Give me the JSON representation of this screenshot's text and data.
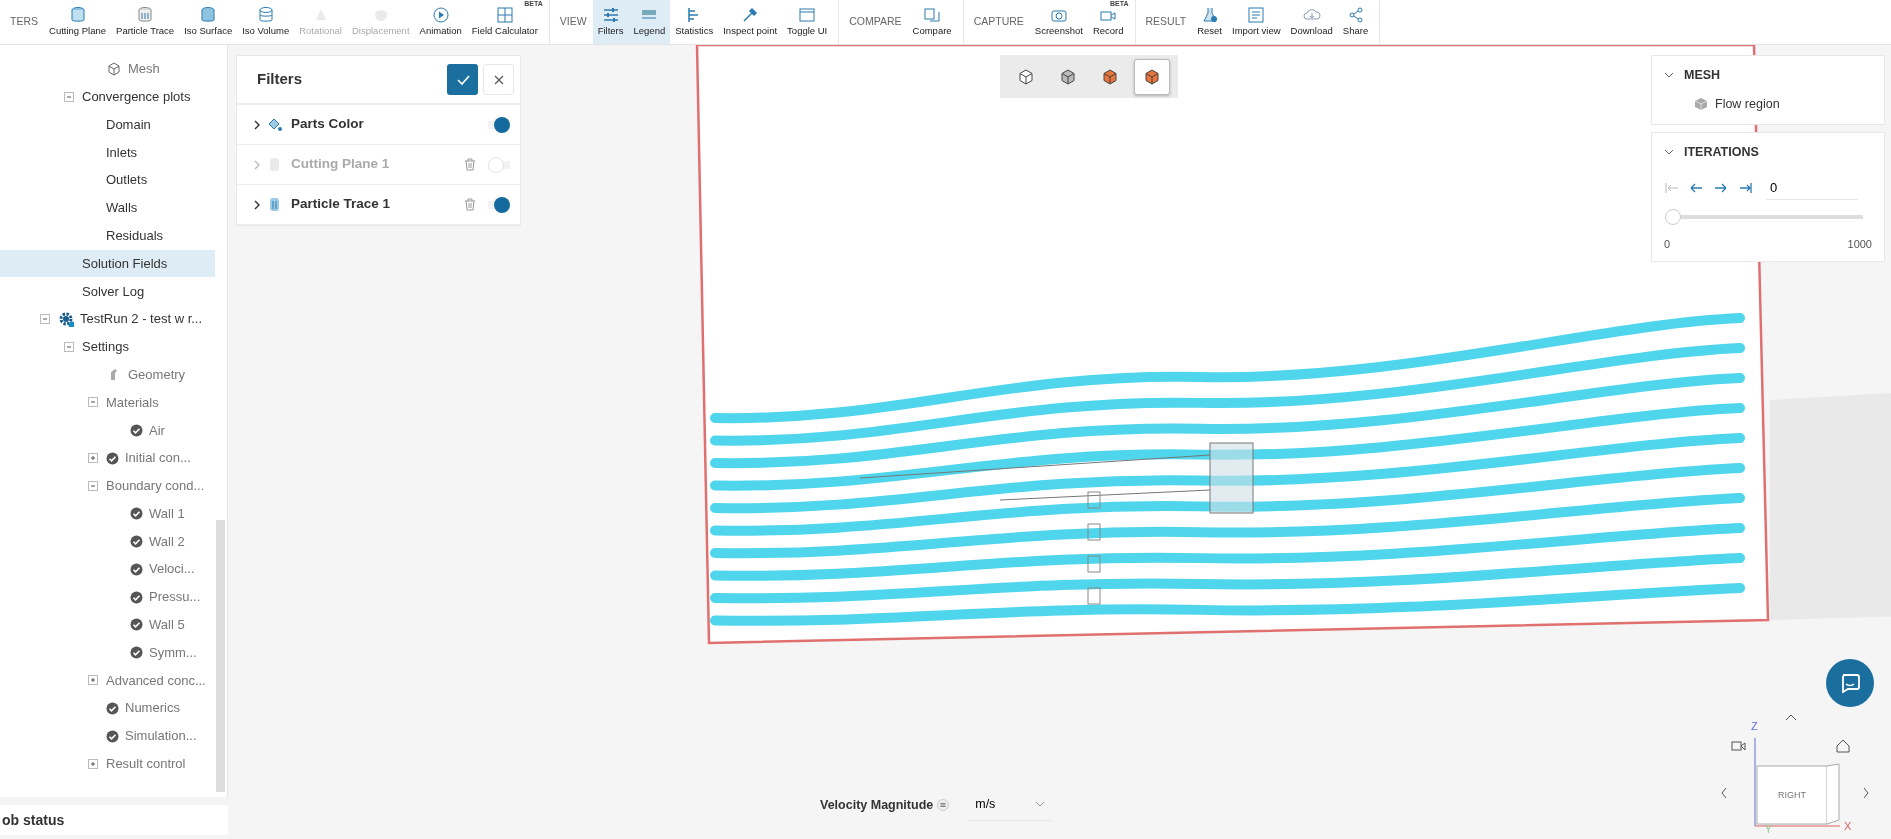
{
  "toolbar": {
    "groups": [
      {
        "label": "TERS",
        "items": [
          {
            "label": "Cutting Plane",
            "selected": false,
            "disabled": false
          },
          {
            "label": "Particle Trace",
            "selected": false,
            "disabled": false
          },
          {
            "label": "Iso Surface",
            "selected": false,
            "disabled": false
          },
          {
            "label": "Iso Volume",
            "selected": false,
            "disabled": false
          },
          {
            "label": "Rotational",
            "selected": false,
            "disabled": true
          },
          {
            "label": "Displacement",
            "selected": false,
            "disabled": true
          },
          {
            "label": "Animation",
            "selected": false,
            "disabled": false
          },
          {
            "label": "Field Calculator",
            "selected": false,
            "disabled": false,
            "badge": "BETA"
          }
        ]
      },
      {
        "label": "VIEW",
        "items": [
          {
            "label": "Filters",
            "selected": true,
            "disabled": false
          },
          {
            "label": "Legend",
            "selected": true,
            "disabled": false
          },
          {
            "label": "Statistics",
            "selected": false,
            "disabled": false
          },
          {
            "label": "Inspect point",
            "selected": false,
            "disabled": false
          },
          {
            "label": "Toggle UI",
            "selected": false,
            "disabled": false
          }
        ]
      },
      {
        "label": "COMPARE",
        "items": [
          {
            "label": "Compare",
            "selected": false,
            "disabled": false
          }
        ]
      },
      {
        "label": "CAPTURE",
        "items": [
          {
            "label": "Screenshot",
            "selected": false,
            "disabled": false
          },
          {
            "label": "Record",
            "selected": false,
            "disabled": false,
            "badge": "BETA"
          }
        ]
      },
      {
        "label": "RESULT",
        "items": [
          {
            "label": "Reset",
            "selected": false,
            "disabled": false
          },
          {
            "label": "Import view",
            "selected": false,
            "disabled": false
          },
          {
            "label": "Download",
            "selected": false,
            "disabled": false
          },
          {
            "label": "Share",
            "selected": false,
            "disabled": false
          }
        ]
      }
    ]
  },
  "tree": [
    {
      "children": [
        {
          "children": [
            {
              "label": "Mesh",
              "kind": "mesh",
              "muted": true
            }
          ]
        },
        {
          "label": "Convergence plots",
          "expanded": true,
          "children": [
            {
              "label": "Domain"
            },
            {
              "label": "Inlets"
            },
            {
              "label": "Outlets"
            },
            {
              "label": "Walls"
            },
            {
              "label": "Residuals"
            }
          ]
        },
        {
          "label": "Solution Fields",
          "selected": true
        },
        {
          "label": "Solver Log",
          "selected": false
        }
      ]
    },
    {
      "label": "TestRun 2 - test w r...",
      "kind": "run",
      "expanded": true,
      "children": [
        {
          "label": "Settings",
          "expanded": true,
          "children": [
            {
              "label": "Geometry",
              "kind": "geometry",
              "muted": true
            },
            {
              "label": "Materials",
              "expanded": true,
              "muted": true,
              "children": [
                {
                  "label": "Air",
                  "done": true,
                  "muted": true
                }
              ]
            },
            {
              "label": "Initial con...",
              "expanded": false,
              "done": true,
              "muted": true
            },
            {
              "label": "Boundary cond...",
              "expanded": true,
              "muted": true,
              "children": [
                {
                  "label": "Wall 1",
                  "done": true,
                  "muted": true
                },
                {
                  "label": "Wall 2",
                  "done": true,
                  "muted": true
                },
                {
                  "label": "Veloci...",
                  "done": true,
                  "muted": true
                },
                {
                  "label": "Pressu...",
                  "done": true,
                  "muted": true
                },
                {
                  "label": "Wall 5",
                  "done": true,
                  "muted": true
                },
                {
                  "label": "Symm...",
                  "done": true,
                  "muted": true
                }
              ]
            },
            {
              "label": "Advanced conc...",
              "expanded": false,
              "muted": true
            },
            {
              "label": "Numerics",
              "done": true,
              "muted": true
            },
            {
              "label": "Simulation...",
              "done": true,
              "muted": true
            },
            {
              "label": "Result control",
              "expanded": false,
              "muted": true
            }
          ]
        }
      ]
    }
  ],
  "job_status": {
    "title": "ob status"
  },
  "filters": {
    "title": "Filters",
    "rows": [
      {
        "label": "Parts Color",
        "kind": "parts-color",
        "on": true,
        "disabled": false,
        "deletable": false
      },
      {
        "label": "Cutting Plane 1",
        "kind": "cutting-plane",
        "on": false,
        "disabled": true,
        "deletable": true
      },
      {
        "label": "Particle Trace 1",
        "kind": "particle-trace",
        "on": true,
        "disabled": false,
        "deletable": true
      }
    ]
  },
  "view_modes": [
    {
      "selected": false
    },
    {
      "selected": false
    },
    {
      "selected": false
    },
    {
      "selected": true
    }
  ],
  "mesh_panel": {
    "title": "MESH",
    "items": [
      {
        "label": "Flow region"
      }
    ]
  },
  "iterations": {
    "title": "ITERATIONS",
    "value": "0",
    "level": 0,
    "min": "0",
    "max": "1000"
  },
  "legend": {
    "label": "Velocity Magnitude",
    "unit": "m/s"
  },
  "nav_cube": {
    "face": "RIGHT",
    "axes": [
      "Z",
      "X",
      "Y"
    ]
  }
}
